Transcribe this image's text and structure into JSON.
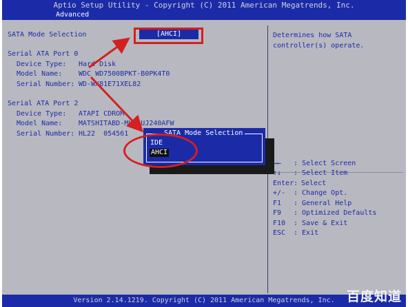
{
  "header": {
    "title": "Aptio Setup Utility - Copyright (C) 2011 American Megatrends, Inc.",
    "tab_advanced": "Advanced"
  },
  "settings": {
    "sata_mode_label": "SATA Mode Selection",
    "sata_mode_value": "[AHCI]",
    "port0": {
      "heading": "Serial ATA Port 0",
      "rows": [
        {
          "label": "Device Type:",
          "value": "Hard Disk"
        },
        {
          "label": "Model Name:",
          "value": "WDC WD7500BPKT-B0PK4T0"
        },
        {
          "label": "Serial Number:",
          "value": "WD-WX81E71XEL82"
        }
      ]
    },
    "port2": {
      "heading": "Serial ATA Port 2",
      "rows": [
        {
          "label": "Device Type:",
          "value": "ATAPI CDROM"
        },
        {
          "label": "Model Name:",
          "value": "MATSHITABD-ML  UJ240AFW"
        },
        {
          "label": "Serial Number:",
          "value": "HL22  054561"
        }
      ]
    }
  },
  "popup": {
    "title": "SATA Mode Selection",
    "options": [
      "IDE",
      "AHCI"
    ],
    "selected": "AHCI"
  },
  "help": {
    "description": [
      "Determines how SATA",
      "controller(s) operate."
    ],
    "keys": [
      {
        "key": "→←",
        "action": ": Select Screen"
      },
      {
        "key": "↑↓",
        "action": ": Select Item"
      },
      {
        "key": "Enter:",
        "action": "Select"
      },
      {
        "key": "+/-",
        "action": ": Change Opt."
      },
      {
        "key": "F1",
        "action": ": General Help"
      },
      {
        "key": "F9",
        "action": ": Optimized Defaults"
      },
      {
        "key": "F10",
        "action": ": Save & Exit"
      },
      {
        "key": "ESC",
        "action": ": Exit"
      }
    ]
  },
  "footer": {
    "version": "Version 2.14.1219. Copyright (C) 2011 American Megatrends, Inc."
  },
  "watermark": "百度知道",
  "colors": {
    "bios_blue": "#1b2ba8",
    "panel_gray": "#b8b8c0",
    "annotation_red": "#d32020"
  }
}
